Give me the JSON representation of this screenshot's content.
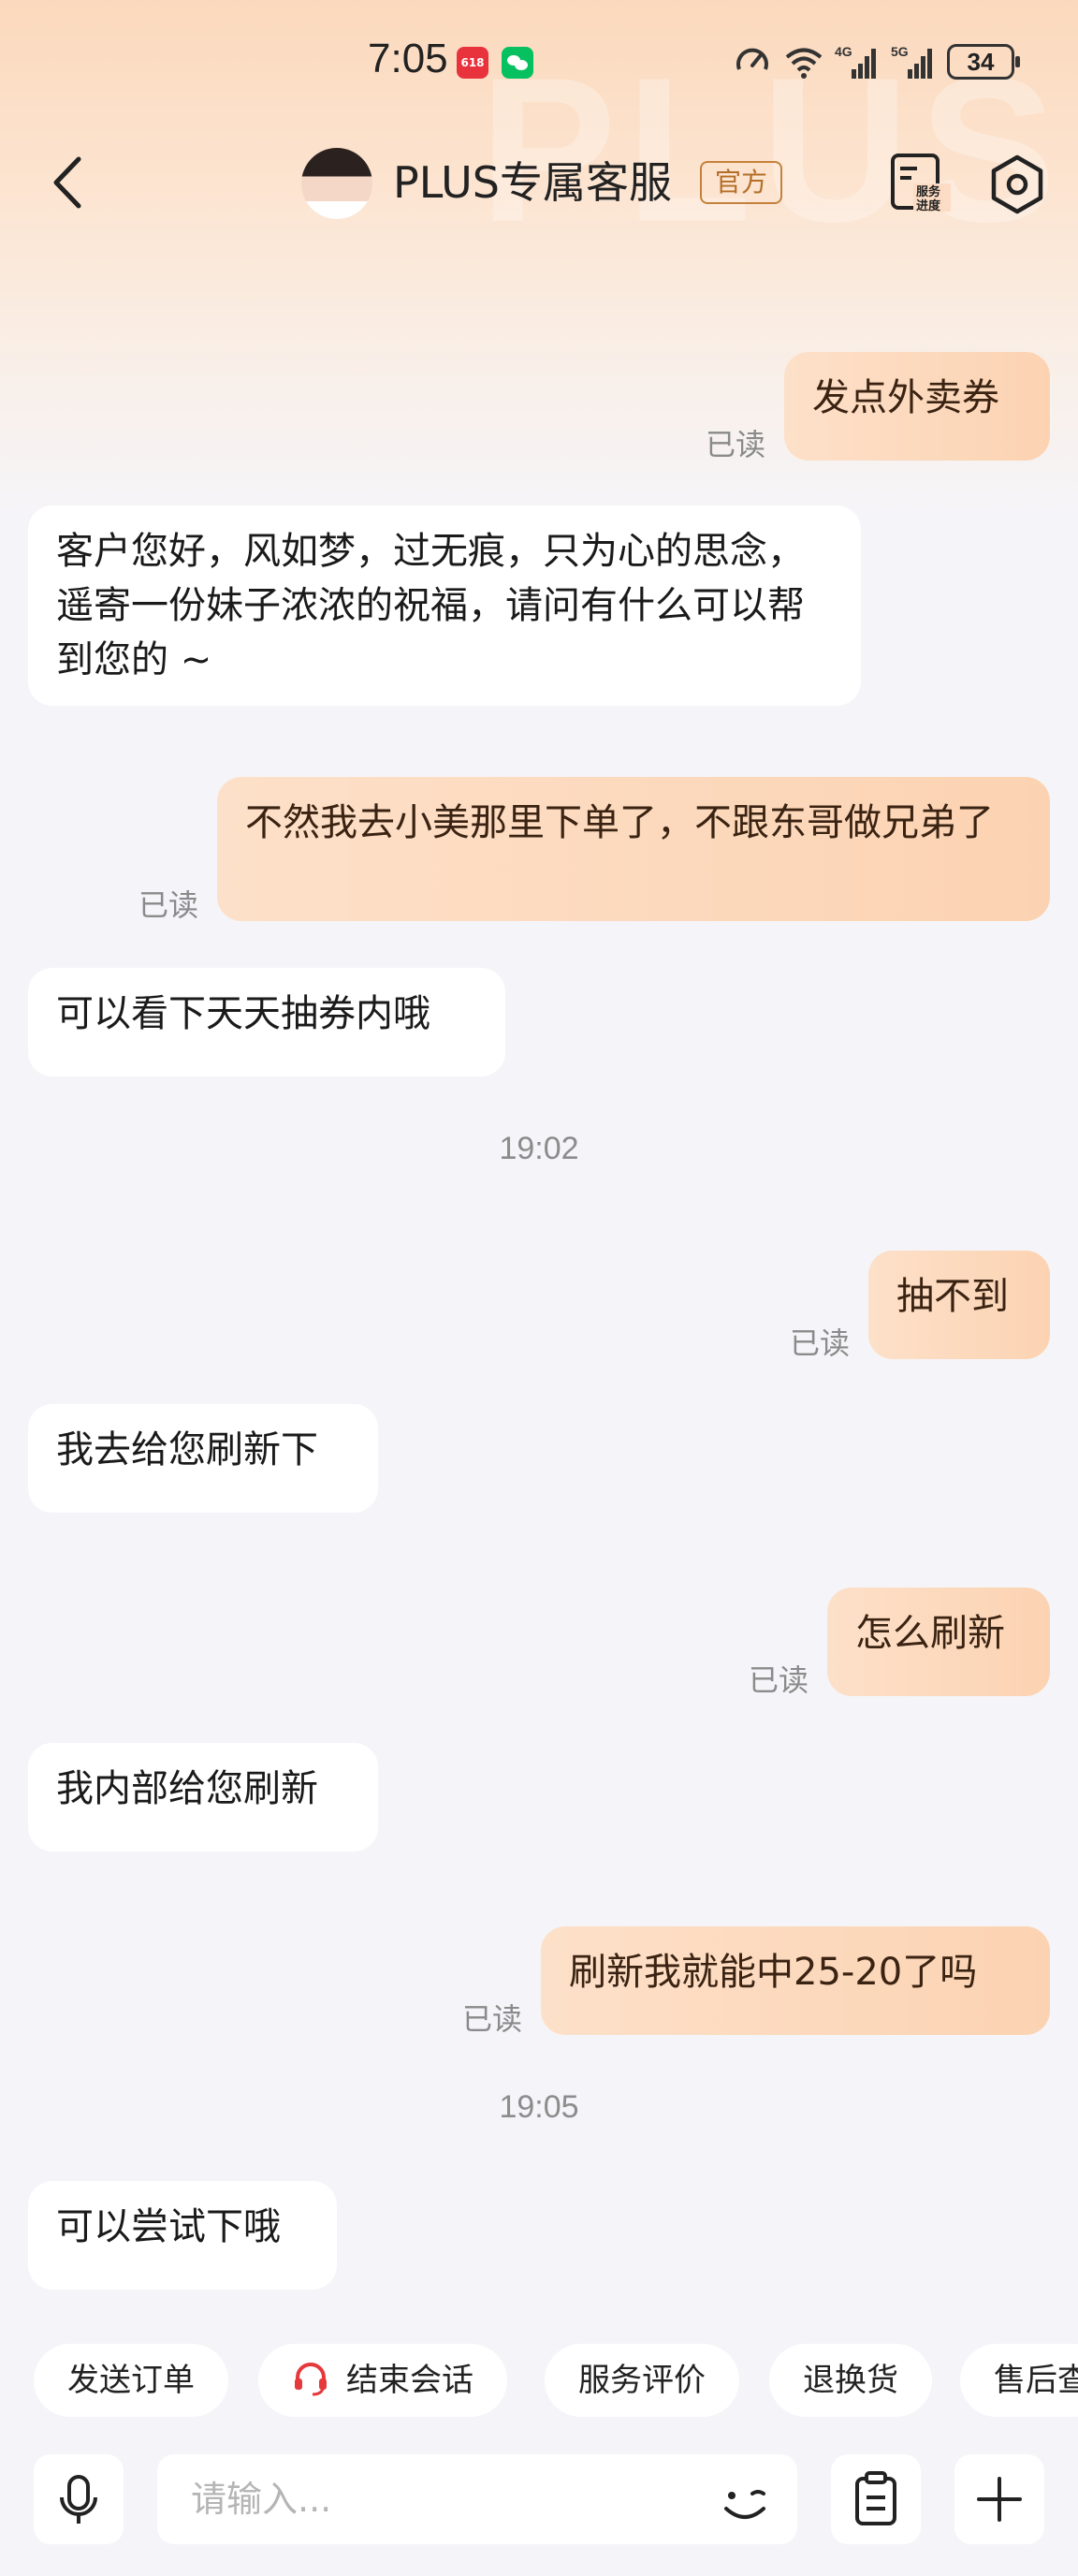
{
  "status_bar": {
    "time": "7:05",
    "battery": "34",
    "app_icon_1_text": "618",
    "network_labels": [
      "4G",
      "5G"
    ]
  },
  "header": {
    "title": "PLUS专属客服",
    "badge": "官方",
    "service_progress_label": "服务进度",
    "watermark": "PLUS"
  },
  "messages": [
    {
      "side": "right",
      "text": "发点外卖券",
      "status": "已读"
    },
    {
      "side": "left",
      "text": "客户您好，风如梦，过无痕，只为心的思念，遥寄一份妹子浓浓的祝福，请问有什么可以帮到您的 ~"
    },
    {
      "side": "right",
      "text": "不然我去小美那里下单了，不跟东哥做兄弟了",
      "status": "已读"
    },
    {
      "side": "left",
      "text": "可以看下天天抽券内哦"
    },
    {
      "timestamp": "19:02"
    },
    {
      "side": "right",
      "text": "抽不到",
      "status": "已读"
    },
    {
      "side": "left",
      "text": "我去给您刷新下"
    },
    {
      "side": "right",
      "text": "怎么刷新",
      "status": "已读"
    },
    {
      "side": "left",
      "text": "我内部给您刷新"
    },
    {
      "side": "right",
      "text": "刷新我就能中25-20了吗",
      "status": "已读"
    },
    {
      "timestamp": "19:05"
    },
    {
      "side": "left",
      "text": "可以尝试下哦"
    }
  ],
  "quick_actions": [
    "发送订单",
    "结束会话",
    "服务评价",
    "退换货",
    "售后查"
  ],
  "input": {
    "placeholder": "请输入...",
    "value": ""
  },
  "colors": {
    "accent_orange": "#fcd3b2",
    "badge_border": "#c4813b",
    "background": "#f5f5f9",
    "headset_red": "#e5393b"
  },
  "icons": [
    "back-icon",
    "service-progress-icon",
    "settings-icon",
    "microphone-icon",
    "emoji-icon",
    "clipboard-icon",
    "plus-icon",
    "headset-icon",
    "wifi-icon",
    "signal-icon",
    "speed-icon"
  ]
}
